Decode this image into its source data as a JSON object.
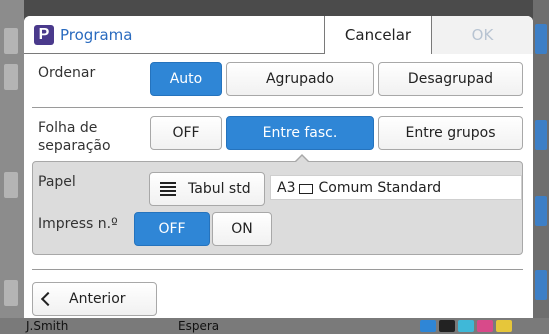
{
  "dialog": {
    "app_badge": "P",
    "title": "Programa",
    "cancel_label": "Cancelar",
    "ok_label": "OK"
  },
  "ordenar": {
    "label": "Ordenar",
    "options": [
      "Auto",
      "Agrupado",
      "Desagrupad"
    ],
    "selected": "Auto"
  },
  "folha": {
    "label_line1": "Folha de",
    "label_line2": "separação",
    "options": [
      "OFF",
      "Entre fasc.",
      "Entre grupos"
    ],
    "selected": "Entre fasc."
  },
  "papel": {
    "label": "Papel",
    "tray_label": "Tabul std",
    "tray_icon": "tray-lines-icon",
    "size": "A3",
    "paper_glyph": "paper-orientation-icon",
    "type": "Comum Standard"
  },
  "impress": {
    "label": "Impress n.º",
    "options": [
      "OFF",
      "ON"
    ],
    "selected": "OFF"
  },
  "footer": {
    "back_label": "Anterior"
  },
  "background": {
    "user": "J.Smith",
    "status": "Espera"
  },
  "colors": {
    "accent": "#2f86d6",
    "title": "#2a6bbf",
    "badge": "#4a3a8c",
    "panel": "#dcdcdc",
    "ok_disabled": "#b8c4d2"
  }
}
